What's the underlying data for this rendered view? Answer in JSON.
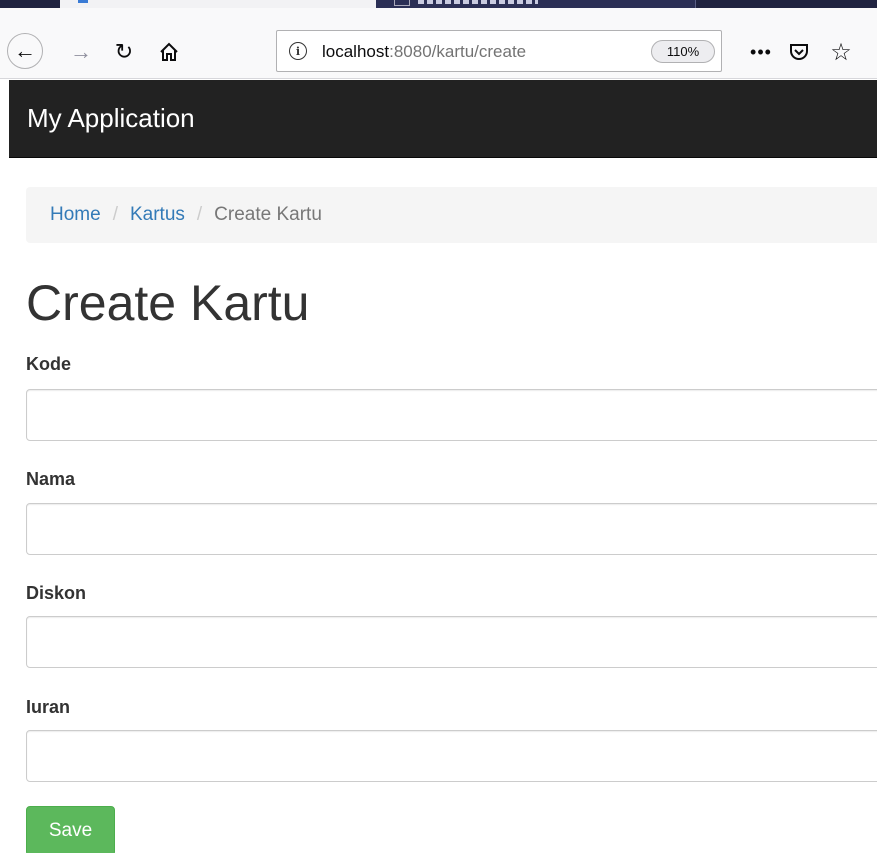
{
  "browser": {
    "url_host": "localhost",
    "url_path": ":8080/kartu/create",
    "zoom": "110%",
    "page_actions_label": "•••"
  },
  "app": {
    "brand": "My Application"
  },
  "breadcrumb": {
    "items": [
      "Home",
      "Kartus",
      "Create Kartu"
    ],
    "separator": "/"
  },
  "page": {
    "title": "Create Kartu"
  },
  "form": {
    "fields": [
      {
        "label": "Kode",
        "value": ""
      },
      {
        "label": "Nama",
        "value": ""
      },
      {
        "label": "Diskon",
        "value": ""
      },
      {
        "label": "Iuran",
        "value": ""
      }
    ],
    "submit_label": "Save"
  },
  "colors": {
    "header_bg": "#222222",
    "link": "#337ab7",
    "save_button": "#5cb85c"
  },
  "icons": [
    "back-arrow-icon",
    "forward-arrow-icon",
    "reload-icon",
    "home-icon",
    "info-icon",
    "pocket-icon",
    "bookmark-star-icon"
  ]
}
